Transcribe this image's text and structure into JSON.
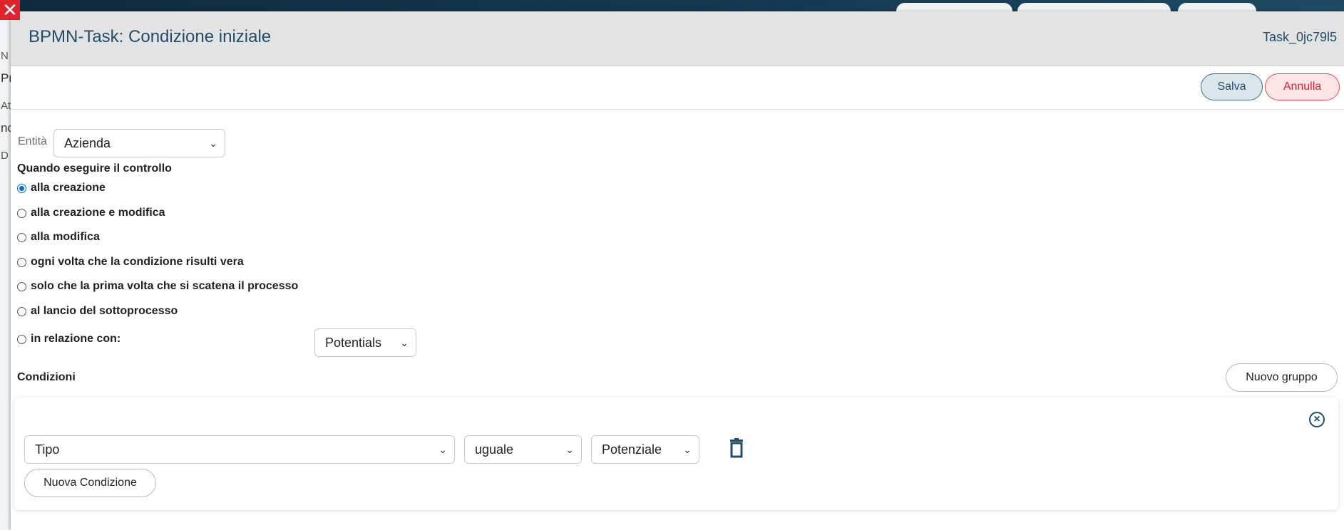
{
  "background": {
    "sidebar_fragments": [
      "N",
      "Pr",
      "At",
      "nc",
      "D"
    ]
  },
  "modal": {
    "title": "BPMN-Task: Condizione iniziale",
    "task_id": "Task_0jc79l5",
    "toolbar": {
      "save_label": "Salva",
      "cancel_label": "Annulla"
    },
    "entity": {
      "label": "Entità",
      "value": "Azienda"
    },
    "when": {
      "label": "Quando eseguire il controllo",
      "options": [
        {
          "label": "alla creazione",
          "checked": true
        },
        {
          "label": "alla creazione e modifica",
          "checked": false
        },
        {
          "label": "alla modifica",
          "checked": false
        },
        {
          "label": "ogni volta che la condizione risulti vera",
          "checked": false
        },
        {
          "label": "solo che la prima volta che si scatena il processo",
          "checked": false
        },
        {
          "label": "al lancio del sottoprocesso",
          "checked": false
        },
        {
          "label": "in relazione con:",
          "checked": false
        }
      ],
      "relation_value": "Potentials"
    },
    "conditions": {
      "label": "Condizioni",
      "new_group_label": "Nuovo gruppo",
      "group": {
        "field_value": "Tipo",
        "operator_value": "uguale",
        "value_value": "Potenziale",
        "new_condition_label": "Nuova Condizione"
      }
    }
  },
  "colors": {
    "accent": "#1f4e6b",
    "danger": "#e1242b",
    "radio_checked": "#0b6fd1"
  }
}
